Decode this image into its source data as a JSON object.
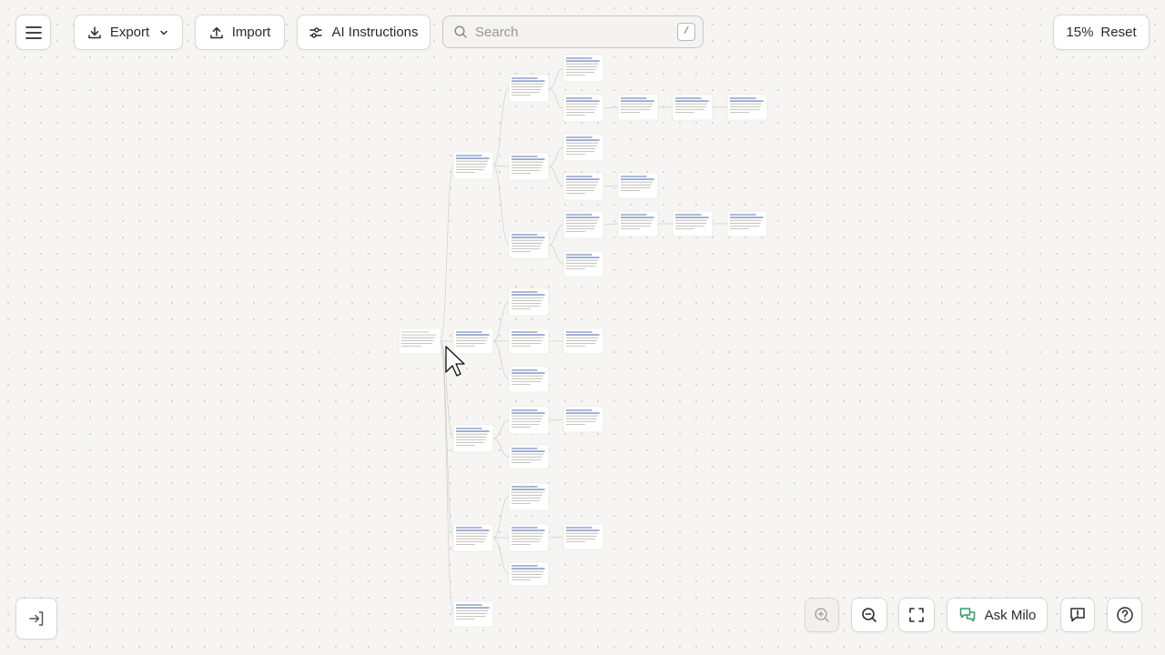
{
  "toolbar": {
    "menu_icon": "hamburger-menu-icon",
    "export_label": "Export",
    "import_label": "Import",
    "ai_label": "AI Instructions",
    "search_placeholder": "Search",
    "search_value": "",
    "search_shortcut": "/",
    "zoom_level": "15%",
    "reset_label": "Reset"
  },
  "bottom": {
    "exit_icon": "sign-in-icon",
    "zoom_in_icon": "zoom-in-icon",
    "zoom_out_icon": "zoom-out-icon",
    "fit_icon": "fullscreen-icon",
    "ask_label": "Ask Milo",
    "feedback_icon": "feedback-icon",
    "help_icon": "help-icon"
  },
  "colors": {
    "background": "#f6f5f3",
    "node_title": "#5b73b0",
    "node_text": "#b5b3ae",
    "ask_icon": "#2f9e6a"
  },
  "mindmap": {
    "note": "Text on the mind-map nodes is rendered at 15% zoom and is not legible in the screenshot; nodes are reproduced as placeholders.",
    "nodes": [
      {
        "id": "root",
        "parent": null
      },
      {
        "id": "a1",
        "parent": "root"
      },
      {
        "id": "a2",
        "parent": "root"
      },
      {
        "id": "a3",
        "parent": "root"
      },
      {
        "id": "a4",
        "parent": "root"
      },
      {
        "id": "a5",
        "parent": "root"
      },
      {
        "id": "b1",
        "parent": "a1"
      },
      {
        "id": "b2",
        "parent": "a1"
      },
      {
        "id": "b3",
        "parent": "a1"
      },
      {
        "id": "b4",
        "parent": "a2"
      },
      {
        "id": "b5",
        "parent": "a2"
      },
      {
        "id": "b6",
        "parent": "a2"
      },
      {
        "id": "b7",
        "parent": "a3"
      },
      {
        "id": "b8",
        "parent": "a3"
      },
      {
        "id": "b9",
        "parent": "a4"
      },
      {
        "id": "b10",
        "parent": "a4"
      },
      {
        "id": "b11",
        "parent": "a4"
      },
      {
        "id": "c1",
        "parent": "b1"
      },
      {
        "id": "c2",
        "parent": "b1"
      },
      {
        "id": "c3",
        "parent": "b2"
      },
      {
        "id": "c4",
        "parent": "b2"
      },
      {
        "id": "c5",
        "parent": "b3"
      },
      {
        "id": "c6",
        "parent": "b3"
      },
      {
        "id": "c7",
        "parent": "b5"
      },
      {
        "id": "c8",
        "parent": "b7"
      },
      {
        "id": "c9",
        "parent": "b10"
      },
      {
        "id": "d1",
        "parent": "c2"
      },
      {
        "id": "d2",
        "parent": "c4"
      },
      {
        "id": "d3",
        "parent": "c5"
      },
      {
        "id": "e1",
        "parent": "d1"
      },
      {
        "id": "e2",
        "parent": "d3"
      },
      {
        "id": "f1",
        "parent": "e1"
      },
      {
        "id": "f2",
        "parent": "e2"
      }
    ]
  }
}
